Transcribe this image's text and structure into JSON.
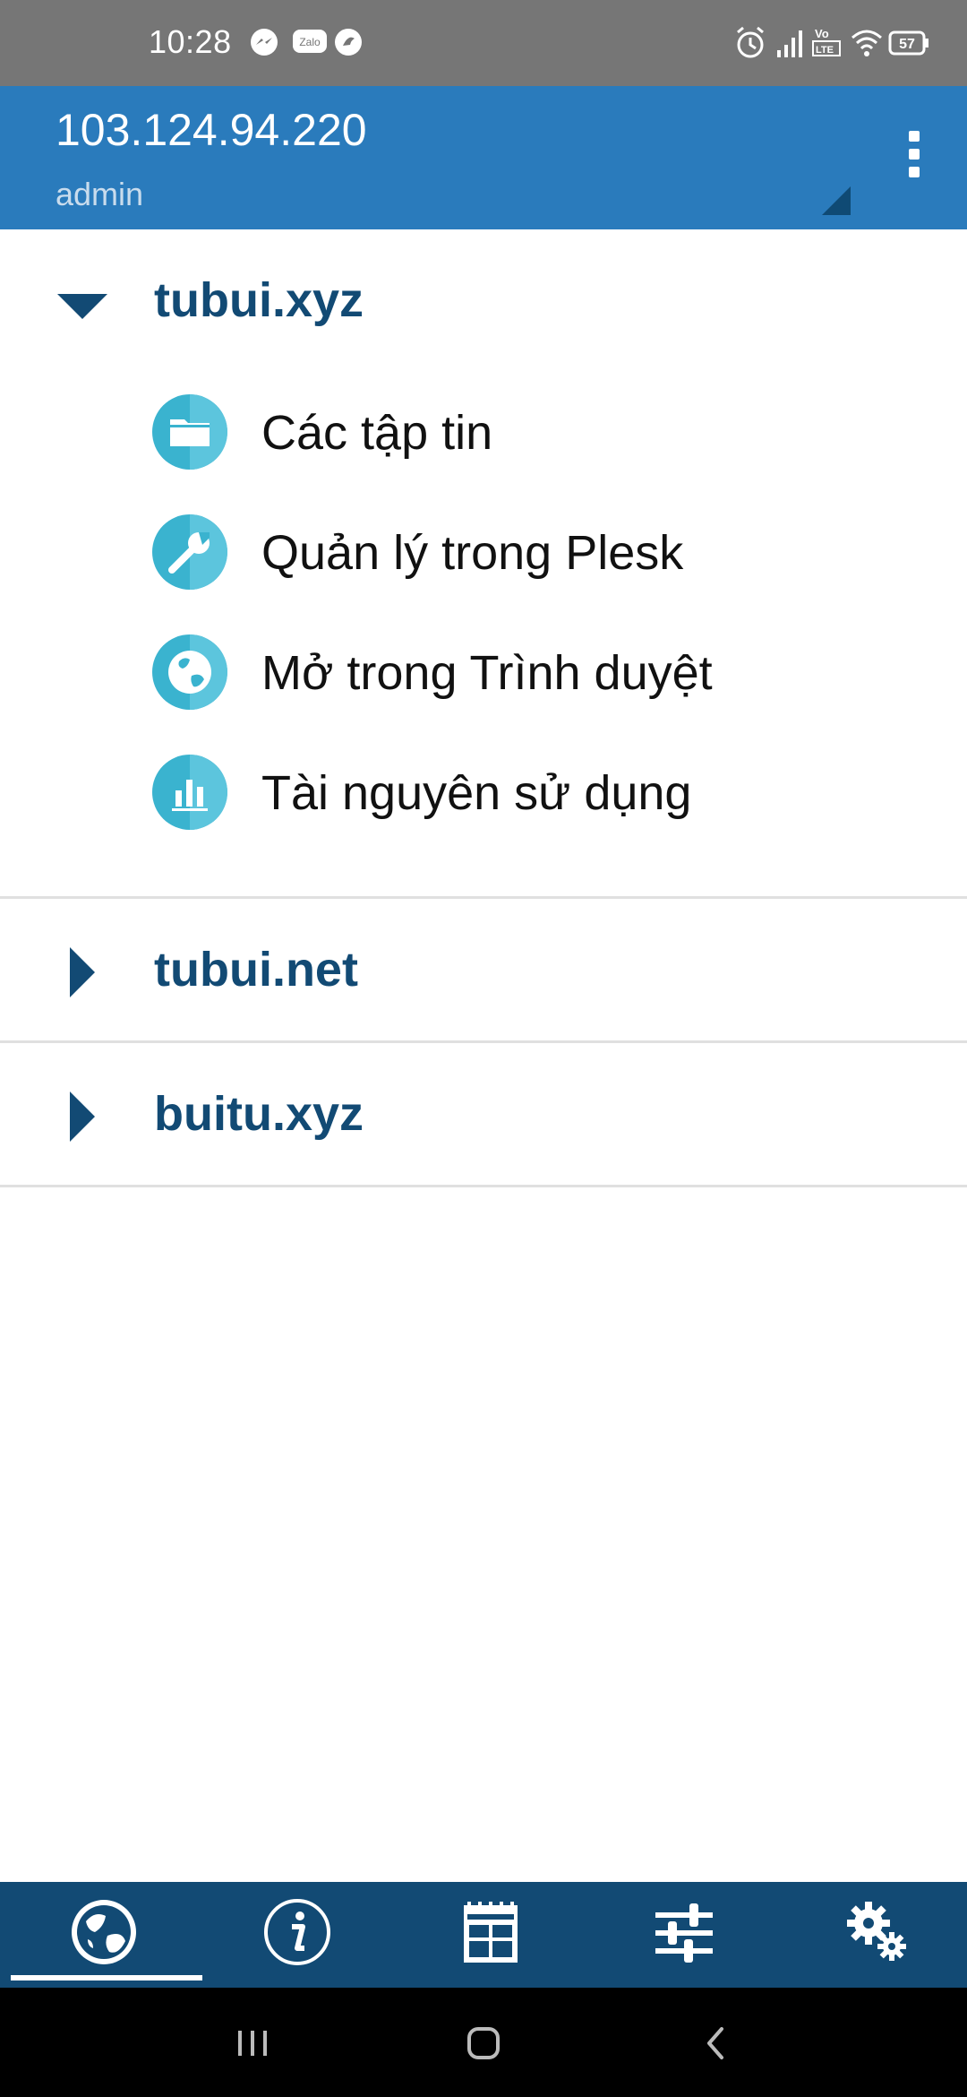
{
  "status_bar": {
    "time": "10:28",
    "left_icons": [
      "messenger-icon",
      "zalo-icon",
      "app-icon"
    ],
    "right_icons": [
      "alarm-icon",
      "signal-icon",
      "volte-icon",
      "wifi-icon",
      "battery-icon"
    ],
    "battery_level": "57",
    "zalo_text": "Zalo"
  },
  "header": {
    "host": "103.124.94.220",
    "user": "admin",
    "overflow_icon": "more-vertical-icon"
  },
  "domains": [
    {
      "name": "tubui.xyz",
      "expanded": true,
      "items": [
        {
          "label": "Các tập tin",
          "icon": "folder-icon"
        },
        {
          "label": "Quản lý trong Plesk",
          "icon": "wrench-icon"
        },
        {
          "label": "Mở trong Trình duyệt",
          "icon": "globe-icon"
        },
        {
          "label": "Tài nguyên sử dụng",
          "icon": "bar-chart-icon"
        }
      ]
    },
    {
      "name": "tubui.net",
      "expanded": false
    },
    {
      "name": "buitu.xyz",
      "expanded": false
    }
  ],
  "bottom_nav": {
    "tabs": [
      "globe-icon",
      "info-icon",
      "dashboard-icon",
      "sliders-icon",
      "gears-icon"
    ],
    "active_index": 0
  },
  "colors": {
    "status_bar": "#767676",
    "header": "#2a7bbc",
    "accent_dark": "#124a74",
    "icon_circle": "#3ab3cf"
  }
}
